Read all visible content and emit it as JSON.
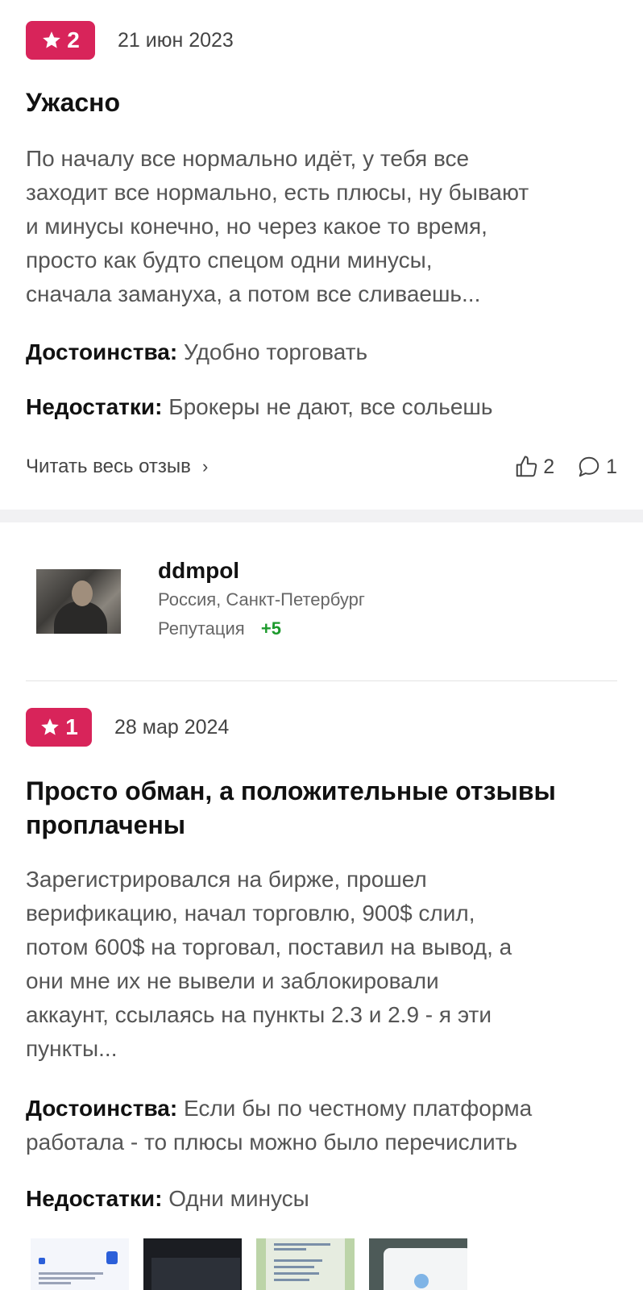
{
  "reviews": [
    {
      "rating": "2",
      "date": "21 июн 2023",
      "title": "Ужасно",
      "text_lines": [
        "По началу все нормально идёт, у тебя все",
        "заходит все нормально, есть плюсы, ну бывают",
        "и минусы конечно, но через какое то время,",
        "просто как будто спецом одни минусы,",
        "сначала замануха, а потом все сливаешь..."
      ],
      "pros_label": "Достоинства:",
      "pros": "Удобно торговать",
      "cons_label": "Недостатки:",
      "cons": "Брокеры не дают, все сольешь",
      "read_more": "Читать весь отзыв",
      "likes": "2",
      "comments": "1"
    },
    {
      "rating": "1",
      "date": "28 мар 2024",
      "title_lines": [
        "Просто обман, а положительные отзывы",
        "проплачены"
      ],
      "text_lines": [
        "Зарегистрировался на бирже, прошел",
        "верификацию, начал торговлю, 900$ слил,",
        "потом 600$ на торговал, поставил на вывод, а",
        "они мне их не вывели и заблокировали",
        "аккаунт, ссылаясь на пункты 2.3 и 2.9 - я эти",
        "пункты..."
      ],
      "pros_label": "Достоинства:",
      "pros_lines": [
        "Если бы по честному платформа",
        "работала - то плюсы можно было перечислить"
      ],
      "cons_label": "Недостатки:",
      "cons": "Одни минусы"
    }
  ],
  "user": {
    "name": "ddmpol",
    "location": "Россия, Санкт-Петербург",
    "reputation_label": "Репутация",
    "reputation_value": "+5"
  },
  "colors": {
    "rating_badge": "#d8245a",
    "reputation_positive": "#1c9a2c",
    "separator": "#f1f1f3"
  },
  "icons": {
    "star": "star-icon",
    "chevron": "chevron-right-icon",
    "like": "thumbs-up-icon",
    "comment": "comment-icon"
  }
}
